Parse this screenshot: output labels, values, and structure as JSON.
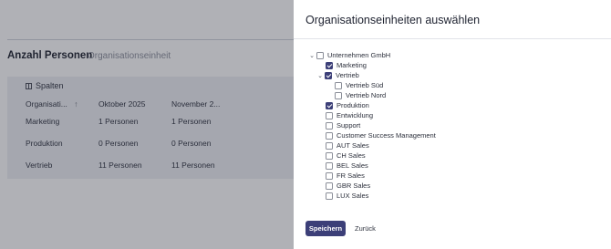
{
  "background": {
    "title": "Anzahl Personen",
    "subtitle": "Organisationseinheit",
    "columns_button": "Spalten",
    "table": {
      "headers": [
        "Organisati...",
        "Oktober 2025",
        "November 2..."
      ],
      "sort_indicator": "↑",
      "rows": [
        [
          "Marketing",
          "1 Personen",
          "1 Personen"
        ],
        [
          "Produktion",
          "0 Personen",
          "0 Personen"
        ],
        [
          "Vertrieb",
          "11 Personen",
          "11 Personen"
        ]
      ]
    }
  },
  "modal": {
    "title": "Organisationseinheiten auswählen",
    "tree": [
      {
        "label": "Unternehmen GmbH",
        "checked": false,
        "expandable": true
      },
      {
        "label": "Marketing",
        "checked": true,
        "expandable": false
      },
      {
        "label": "Vertrieb",
        "checked": true,
        "expandable": true
      },
      {
        "label": "Vertrieb Süd",
        "checked": false,
        "expandable": false
      },
      {
        "label": "Vertrieb Nord",
        "checked": false,
        "expandable": false
      },
      {
        "label": "Produktion",
        "checked": true,
        "expandable": false
      },
      {
        "label": "Entwicklung",
        "checked": false,
        "expandable": false
      },
      {
        "label": "Support",
        "checked": false,
        "expandable": false
      },
      {
        "label": "Customer Success Management",
        "checked": false,
        "expandable": false
      },
      {
        "label": "AUT Sales",
        "checked": false,
        "expandable": false
      },
      {
        "label": "CH Sales",
        "checked": false,
        "expandable": false
      },
      {
        "label": "BEL Sales",
        "checked": false,
        "expandable": false
      },
      {
        "label": "FR Sales",
        "checked": false,
        "expandable": false
      },
      {
        "label": "GBR Sales",
        "checked": false,
        "expandable": false
      },
      {
        "label": "LUX Sales",
        "checked": false,
        "expandable": false
      }
    ],
    "save_label": "Speichern",
    "back_label": "Zurück"
  },
  "colors": {
    "primary": "#3c3f78",
    "overlay": "rgba(35,38,52,0.36)"
  }
}
